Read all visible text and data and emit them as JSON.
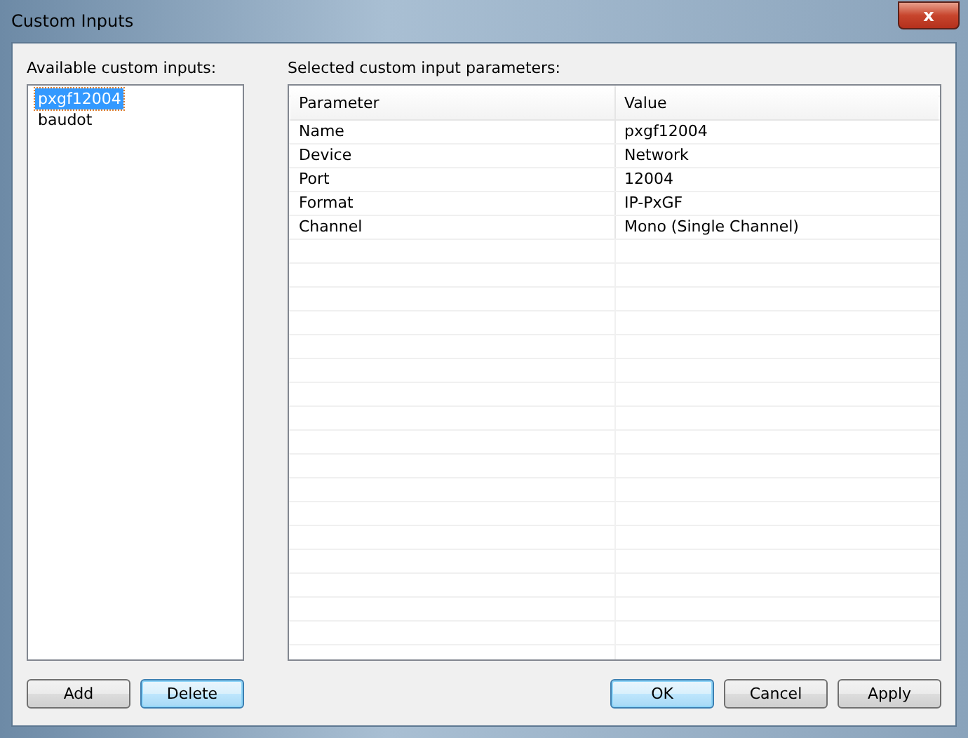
{
  "window": {
    "title": "Custom Inputs",
    "close_label": "x"
  },
  "available": {
    "label": "Available custom inputs:",
    "items": [
      {
        "text": "pxgf12004",
        "selected": true
      },
      {
        "text": "baudot",
        "selected": false
      }
    ]
  },
  "parameters": {
    "label": "Selected custom input parameters:",
    "columns": [
      "Parameter",
      "Value"
    ],
    "rows": [
      [
        "Name",
        "pxgf12004"
      ],
      [
        "Device",
        "Network"
      ],
      [
        "Port",
        "12004"
      ],
      [
        "Format",
        "IP-PxGF"
      ],
      [
        "Channel",
        "Mono (Single Channel)"
      ]
    ]
  },
  "left_buttons": [
    {
      "label": "Add",
      "highlighted": false
    },
    {
      "label": "Delete",
      "highlighted": true
    }
  ],
  "right_buttons": [
    {
      "label": "OK",
      "highlighted": true
    },
    {
      "label": "Cancel",
      "highlighted": false
    },
    {
      "label": "Apply",
      "highlighted": false
    }
  ]
}
